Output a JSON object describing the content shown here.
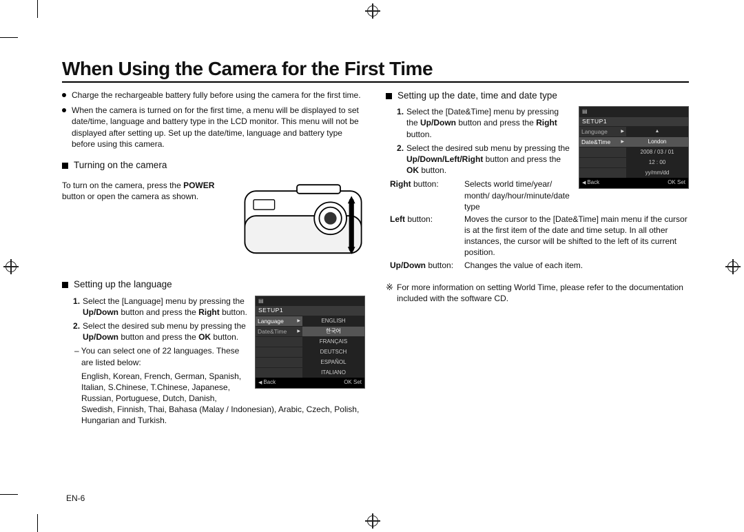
{
  "page_number": "EN-6",
  "title": "When Using the Camera for the First Time",
  "intro": [
    "Charge the rechargeable battery fully before using the camera for the first time.",
    "When the camera is turned on for the first time, a menu will be displayed to set date/time, language and battery type in the LCD monitor. This menu will not be displayed after setting up. Set up the date/time, language and battery type before using this camera."
  ],
  "turn_on": {
    "heading": "Turning on the camera",
    "text_pre": "To turn on the camera, press the ",
    "power": "POWER",
    "text_post": " button or open the camera as shown."
  },
  "lang": {
    "heading": "Setting up the language",
    "step1_a": "Select the [Language] menu by pressing the ",
    "step1_b": "Up/Down",
    "step1_c": " button and press the ",
    "step1_d": "Right",
    "step1_e": " button.",
    "step2_a": "Select the desired sub menu by pressing the ",
    "step2_b": "Up/Down",
    "step2_c": " button and press the ",
    "step2_d": "OK",
    "step2_e": " button.",
    "sub": "You can select one of 22 languages. These are listed below:",
    "list": "English, Korean, French, German, Spanish, Italian, S.Chinese, T.Chinese, Japanese, Russian, Portuguese, Dutch, Danish, Swedish, Finnish, Thai, Bahasa (Malay / Indonesian), Arabic, Czech, Polish, Hungarian and Turkish.",
    "lcd": {
      "setup": "SETUP1",
      "row1_left": "Language",
      "row2_left": "Date&Time",
      "opts": [
        "ENGLISH",
        "한국어",
        "FRANÇAIS",
        "DEUTSCH",
        "ESPAÑOL",
        "ITALIANO"
      ],
      "back": "Back",
      "ok": "OK  Set"
    }
  },
  "date": {
    "heading": "Setting up the date, time and date type",
    "step1_a": "Select the [Date&Time] menu by pressing the ",
    "step1_b": "Up/Down",
    "step1_c": " button and press the ",
    "step1_d": "Right",
    "step1_e": " button.",
    "step2_a": "Select the desired sub menu by pressing the ",
    "step2_b": "Up/Down/Left/Right",
    "step2_c": " button and press the ",
    "step2_d": "OK",
    "step2_e": " button.",
    "defs": {
      "right_k": "Right",
      "right_k2": " button:",
      "right_v": "Selects world time/year/ month/ day/hour/minute/date type",
      "left_k": "Left",
      "left_k2": " button:",
      "left_v": "Moves the cursor to the [Date&Time] main menu if the cursor is at the first item of the date and time setup. In all other instances, the cursor will be shifted to the left of its current position.",
      "ud_k": "Up/Down",
      "ud_k2": " button:",
      "ud_v": "Changes the value of each item."
    },
    "lcd": {
      "setup": "SETUP1",
      "row1_left": "Language",
      "row2_left": "Date&Time",
      "city": "London",
      "datestr": "2008 / 03 / 01",
      "timestr": "12 : 00",
      "fmt": "yy/mm/dd",
      "back": "Back",
      "ok": "OK  Set"
    },
    "note": "For more information on setting World Time, please refer to the documentation included with the software CD."
  }
}
